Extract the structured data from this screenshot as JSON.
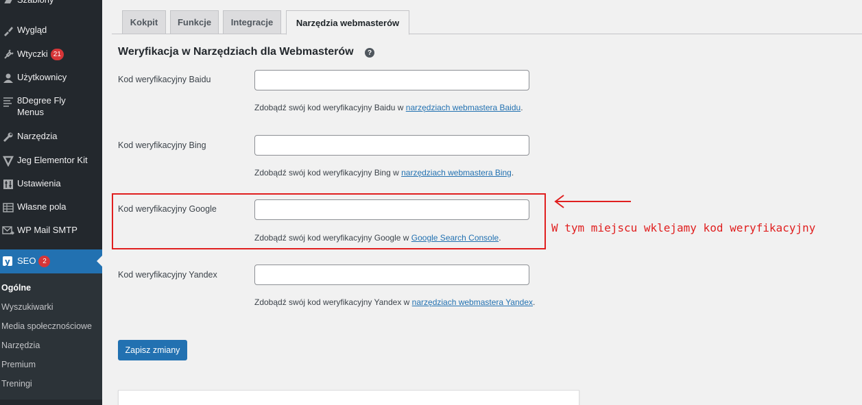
{
  "sidebar": {
    "items": [
      {
        "label": "Szablony",
        "icon": "brush-icon"
      },
      {
        "label": "Wygląd",
        "icon": "paintbrush-icon"
      },
      {
        "label": "Wtyczki",
        "icon": "plugin-icon",
        "badge": "21"
      },
      {
        "label": "Użytkownicy",
        "icon": "user-icon"
      },
      {
        "label": "8Degree Fly Menus",
        "icon": "menu-lines-icon"
      },
      {
        "label": "Narzędzia",
        "icon": "wrench-icon"
      },
      {
        "label": "Jeg Elementor Kit",
        "icon": "jeg-kit-icon"
      },
      {
        "label": "Ustawienia",
        "icon": "settings-icon"
      },
      {
        "label": "Własne pola",
        "icon": "table-icon"
      },
      {
        "label": "WP Mail SMTP",
        "icon": "mail-icon"
      }
    ],
    "seo": {
      "label": "SEO",
      "badge": "2",
      "icon": "yoast-icon"
    },
    "submenu": [
      "Ogólne",
      "Wyszukiwarki",
      "Media społecznościowe",
      "Narzędzia",
      "Premium",
      "Treningi"
    ]
  },
  "tabs": [
    "Kokpit",
    "Funkcje",
    "Integracje",
    "Narzędzia webmasterów"
  ],
  "section_title": "Weryfikacja w Narzędziach dla Webmasterów",
  "fields": [
    {
      "label": "Kod weryfikacyjny Baidu",
      "value": "",
      "desc_prefix": "Zdobądź swój kod weryfikacyjny Baidu w ",
      "link": "narzędziach webmastera Baidu",
      "desc_suffix": "."
    },
    {
      "label": "Kod weryfikacyjny Bing",
      "value": "",
      "desc_prefix": "Zdobądź swój kod weryfikacyjny Bing w ",
      "link": "narzędziach webmastera Bing",
      "desc_suffix": "."
    },
    {
      "label": "Kod weryfikacyjny Google",
      "value": "",
      "desc_prefix": "Zdobądź swój kod weryfikacyjny Google w ",
      "link": "Google Search Console",
      "desc_suffix": "."
    },
    {
      "label": "Kod weryfikacyjny Yandex",
      "value": "",
      "desc_prefix": "Zdobądź swój kod weryfikacyjny Yandex w ",
      "link": "narzędziach webmastera Yandex",
      "desc_suffix": "."
    }
  ],
  "annotation": "W tym miejscu wklejamy kod weryfikacyjny",
  "save_button": "Zapisz zmiany",
  "colors": {
    "sidebar": "#23282d",
    "accent": "#2271b1",
    "annotation": "#e01e1e",
    "badge": "#d63638"
  }
}
